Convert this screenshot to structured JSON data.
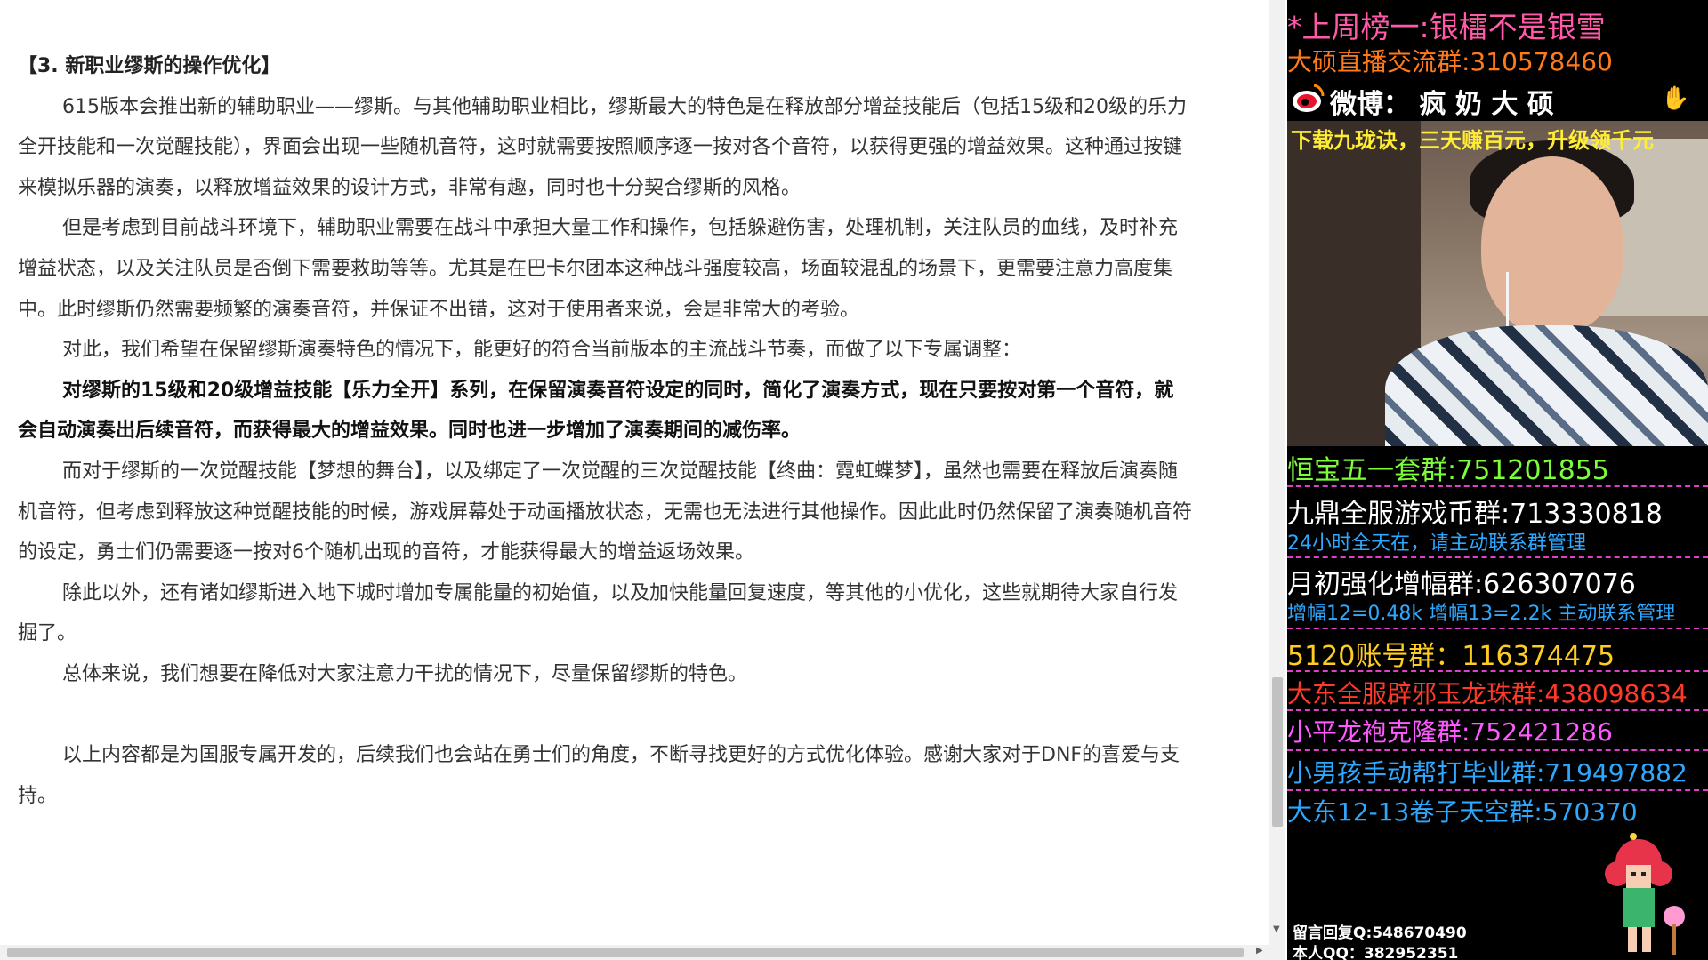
{
  "article": {
    "heading": "【3. 新职业缪斯的操作优化】",
    "paragraphs": [
      "615版本会推出新的辅助职业——缪斯。与其他辅助职业相比，缪斯最大的特色是在释放部分增益技能后（包括15级和20级的乐力全开技能和一次觉醒技能），界面会出现一些随机音符，这时就需要按照顺序逐一按对各个音符，以获得更强的增益效果。这种通过按键来模拟乐器的演奏，以释放增益效果的设计方式，非常有趣，同时也十分契合缪斯的风格。",
      "但是考虑到目前战斗环境下，辅助职业需要在战斗中承担大量工作和操作，包括躲避伤害，处理机制，关注队员的血线，及时补充增益状态，以及关注队员是否倒下需要救助等等。尤其是在巴卡尔团本这种战斗强度较高，场面较混乱的场景下，更需要注意力高度集中。此时缪斯仍然需要频繁的演奏音符，并保证不出错，这对于使用者来说，会是非常大的考验。",
      "对此，我们希望在保留缪斯演奏特色的情况下，能更好的符合当前版本的主流战斗节奏，而做了以下专属调整：",
      "对缪斯的15级和20级增益技能【乐力全开】系列，在保留演奏音符设定的同时，简化了演奏方式，现在只要按对第一个音符，就会自动演奏出后续音符，而获得最大的增益效果。同时也进一步增加了演奏期间的减伤率。",
      "而对于缪斯的一次觉醒技能【梦想的舞台】，以及绑定了一次觉醒的三次觉醒技能【终曲：霓虹蝶梦】，虽然也需要在释放后演奏随机音符，但考虑到释放这种觉醒技能的时候，游戏屏幕处于动画播放状态，无需也无法进行其他操作。因此此时仍然保留了演奏随机音符的设定，勇士们仍需要逐一按对6个随机出现的音符，才能获得最大的增益返场效果。",
      "除此以外，还有诸如缪斯进入地下城时增加专属能量的初始值，以及加快能量回复速度，等其他的小优化，这些就期待大家自行发掘了。",
      "总体来说，我们想要在降低对大家注意力干扰的情况下，尽量保留缪斯的特色。",
      "以上内容都是为国服专属开发的，后续我们也会站在勇士们的角度，不断寻找更好的方式优化体验。感谢大家对于DNF的喜爱与支持。"
    ]
  },
  "overlay": {
    "line1": "*上周榜一:银檑不是银雪",
    "line2": "大硕直播交流群:310578460",
    "weibo": "微博： 疯 奶 大 硕",
    "promo": "下载九珑诀，三天赚百元，升级领千元",
    "groups": [
      {
        "text": "恒宝五一套群:751201855",
        "color": "#7cff3a"
      },
      {
        "text": "九鼎全服游戏币群:713330818",
        "color": "#ffffff"
      },
      {
        "text": "24小时全天在，请主动联系群管理",
        "color": "#2ea8ff"
      },
      {
        "text": "月初强化增幅群:626307076",
        "color": "#ffffff"
      },
      {
        "text": "增幅12=0.48k 增幅13=2.2k 主动联系管理",
        "color": "#2ea8ff"
      },
      {
        "text": "5120账号群：116374475",
        "color": "#ffcc22"
      },
      {
        "text": "大东全服辟邪玉龙珠群:438098634",
        "color": "#ff3a2a"
      },
      {
        "text": "小平龙袍克隆群:752421286",
        "color": "#ff5aff"
      },
      {
        "text": "小男孩手动帮打毕业群:719497882",
        "color": "#2ea8ff"
      },
      {
        "text": "大东12-13卷子天空群:570370",
        "color": "#2ea8ff"
      }
    ],
    "contact1": "留言回复Q:548670490",
    "contact2": "本人QQ：382952351",
    "colors": {
      "line1": "#ff5aa8",
      "line2": "#ff7a1a",
      "promo": "#ffee33",
      "dash": "#e040c8"
    }
  }
}
